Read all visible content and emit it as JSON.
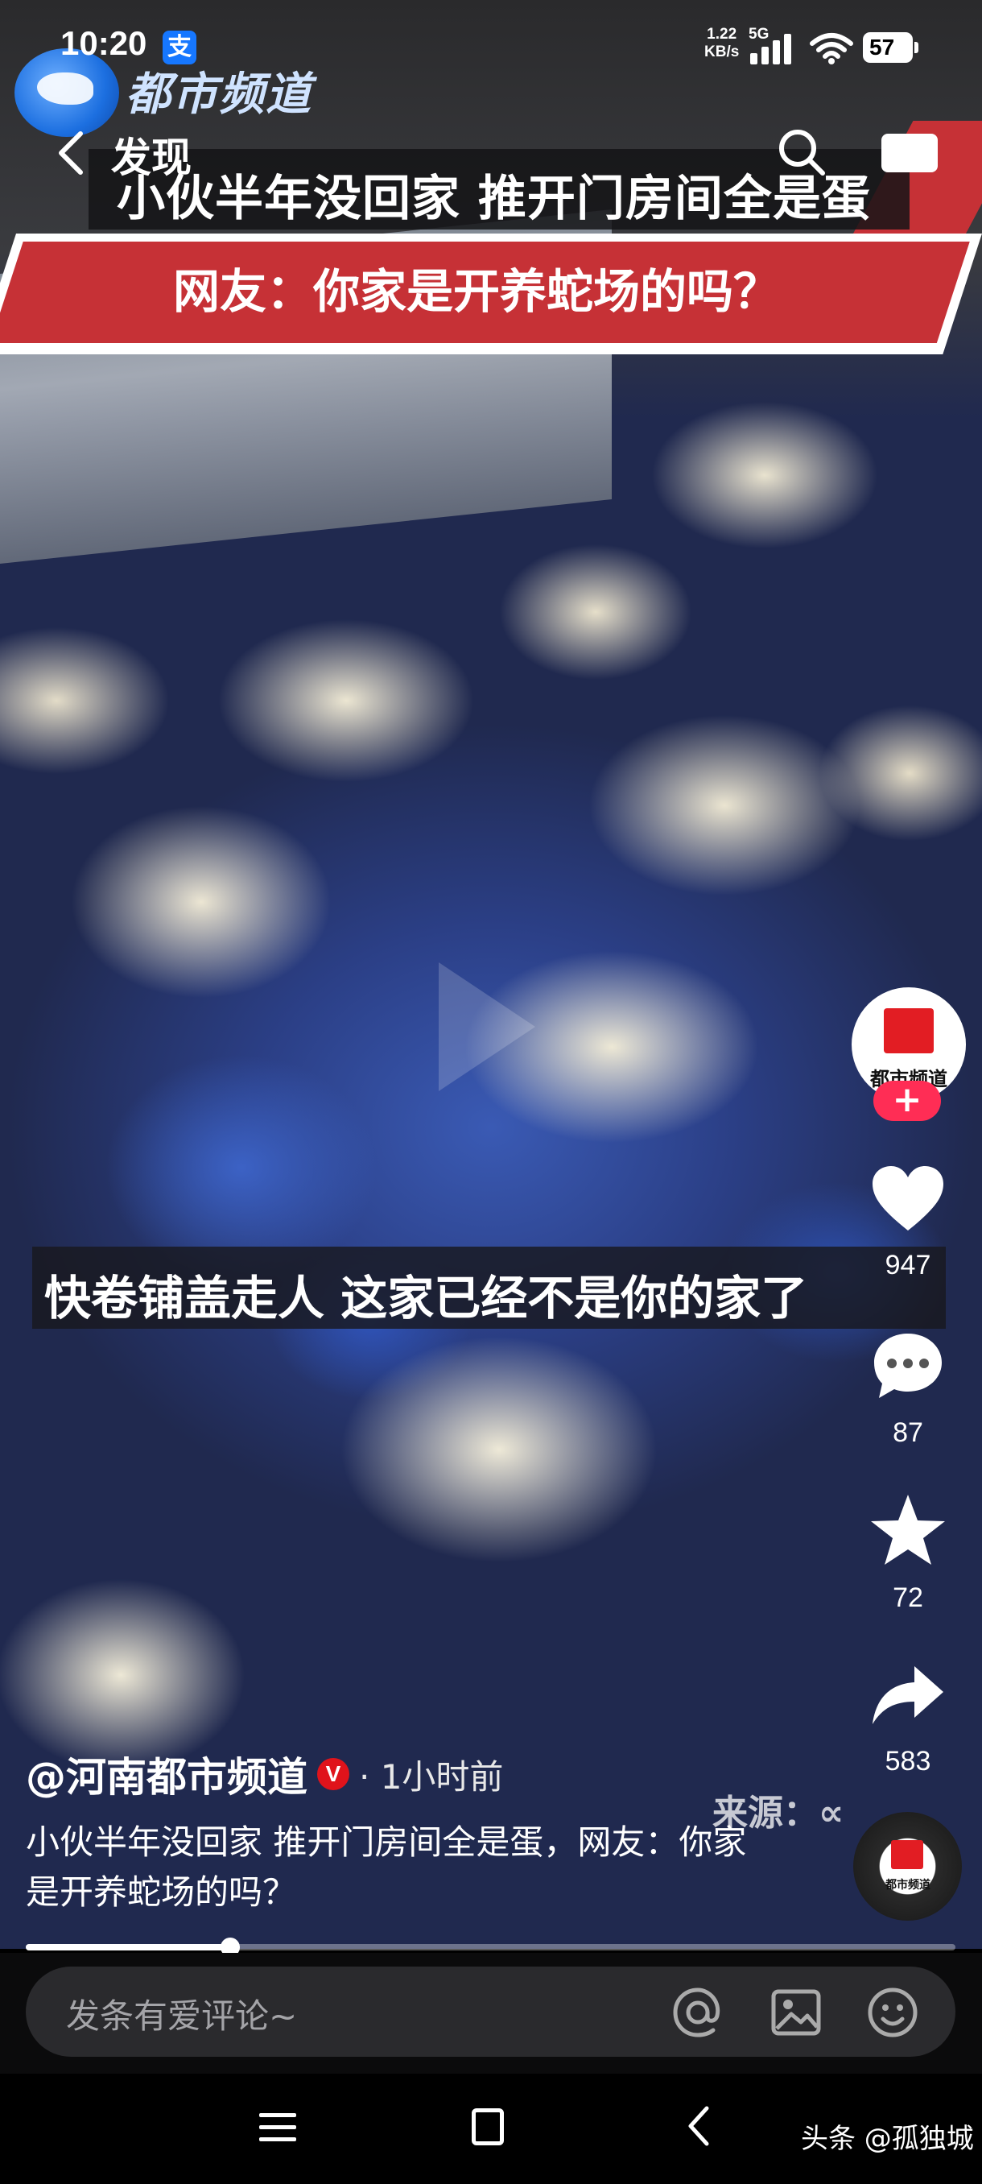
{
  "status_bar": {
    "time": "10:20",
    "alipay_icon": "支",
    "net_speed_value": "1.22",
    "net_speed_unit": "KB/s",
    "network": "5G",
    "battery": "57"
  },
  "channel_logo": {
    "name": "都市频道"
  },
  "top_nav": {
    "back_label": "发现",
    "icons": [
      "chevron-left-icon",
      "search-icon",
      "screen-icon"
    ]
  },
  "video": {
    "headline_top": "小伙半年没回家 推开门房间全是蛋",
    "headline_bottom": "网友：你家是开养蛇场的吗？",
    "subtitle": "快卷铺盖走人 这家已经不是你的家了",
    "source_watermark": "来源：∝",
    "colors": {
      "banner_red": "#c63136",
      "follow_pink": "#ff2d55",
      "badge_red": "#e0131b"
    }
  },
  "side_actions": {
    "avatar_label": "都市频道",
    "follow_symbol": "+",
    "like_count": "947",
    "comment_count": "87",
    "favorite_count": "72",
    "share_count": "583",
    "disc_label": "都市频道"
  },
  "post": {
    "author": "@河南都市频道",
    "verified_badge": "V",
    "time": "· 1小时前",
    "description": "小伙半年没回家 推开门房间全是蛋，网友：你家是开养蛇场的吗？"
  },
  "progress": {
    "fraction": 0.22
  },
  "comment_bar": {
    "placeholder": "发条有爱评论~",
    "icons": [
      "at-icon",
      "image-icon",
      "emoji-icon"
    ]
  },
  "nav_bar": {
    "icons": [
      "menu-icon",
      "home-icon",
      "back-icon"
    ]
  },
  "source_tag": "头条 @孤独城"
}
